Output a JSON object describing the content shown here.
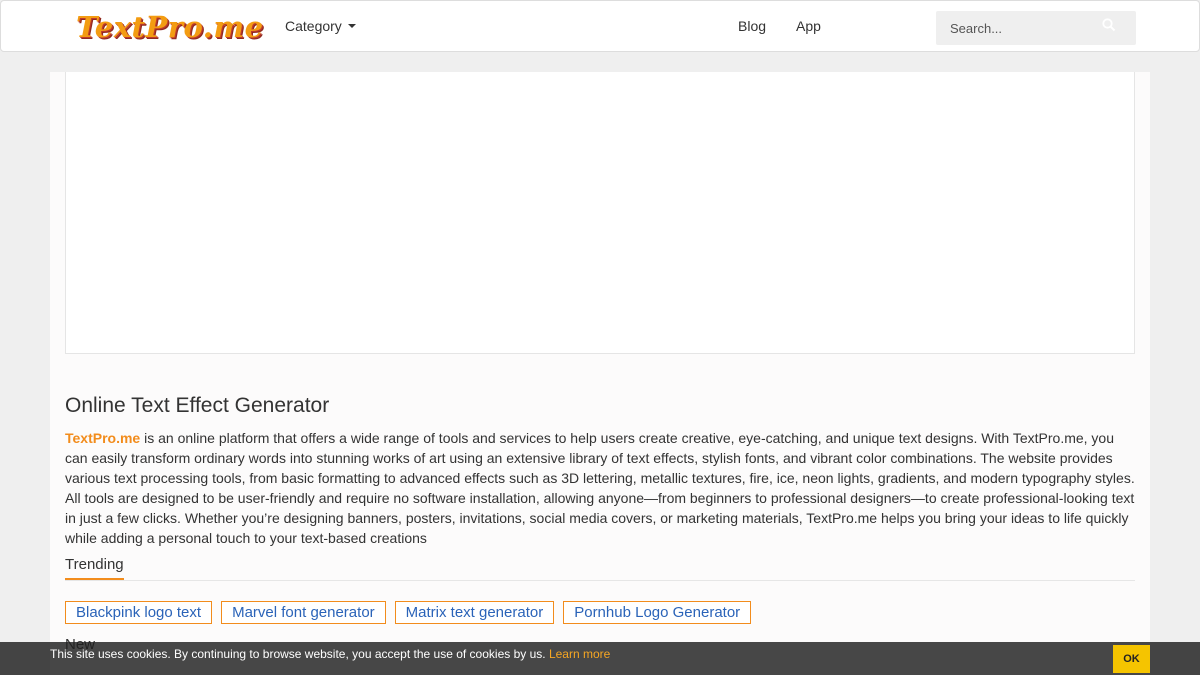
{
  "header": {
    "logo_text": "TextPro.me",
    "category_label": "Category",
    "nav": [
      "Blog",
      "App"
    ],
    "search_placeholder": "Search..."
  },
  "main": {
    "title": "Online Text Effect Generator",
    "brand": "TextPro.me",
    "description": " is an online platform that offers a wide range of tools and services to help users create creative, eye-catching, and unique text designs. With TextPro.me, you can easily transform ordinary words into stunning works of art using an extensive library of text effects, stylish fonts, and vibrant color combinations. The website provides various text processing tools, from basic formatting to advanced effects such as 3D lettering, metallic textures, fire, ice, neon lights, gradients, and modern typography styles. All tools are designed to be user-friendly and require no software installation, allowing anyone—from beginners to professional designers—to create professional-looking text in just a few clicks. Whether you’re designing banners, posters, invitations, social media covers, or marketing materials, TextPro.me helps you bring your ideas to life quickly while adding a personal touch to your text-based creations",
    "trending_heading": "Trending",
    "trending_tags": [
      "Blackpink logo text",
      "Marvel font generator",
      "Matrix text generator",
      "Pornhub Logo Generator"
    ],
    "new_heading": "New"
  },
  "cookie_bar": {
    "text": "This site uses cookies. By continuing to browse website, you accept the use of cookies by us. ",
    "learn_more": "Learn more",
    "ok_label": "OK"
  },
  "colors": {
    "accent": "#f28c1c",
    "link": "#2a63b8",
    "ok_button": "#f5c400"
  }
}
